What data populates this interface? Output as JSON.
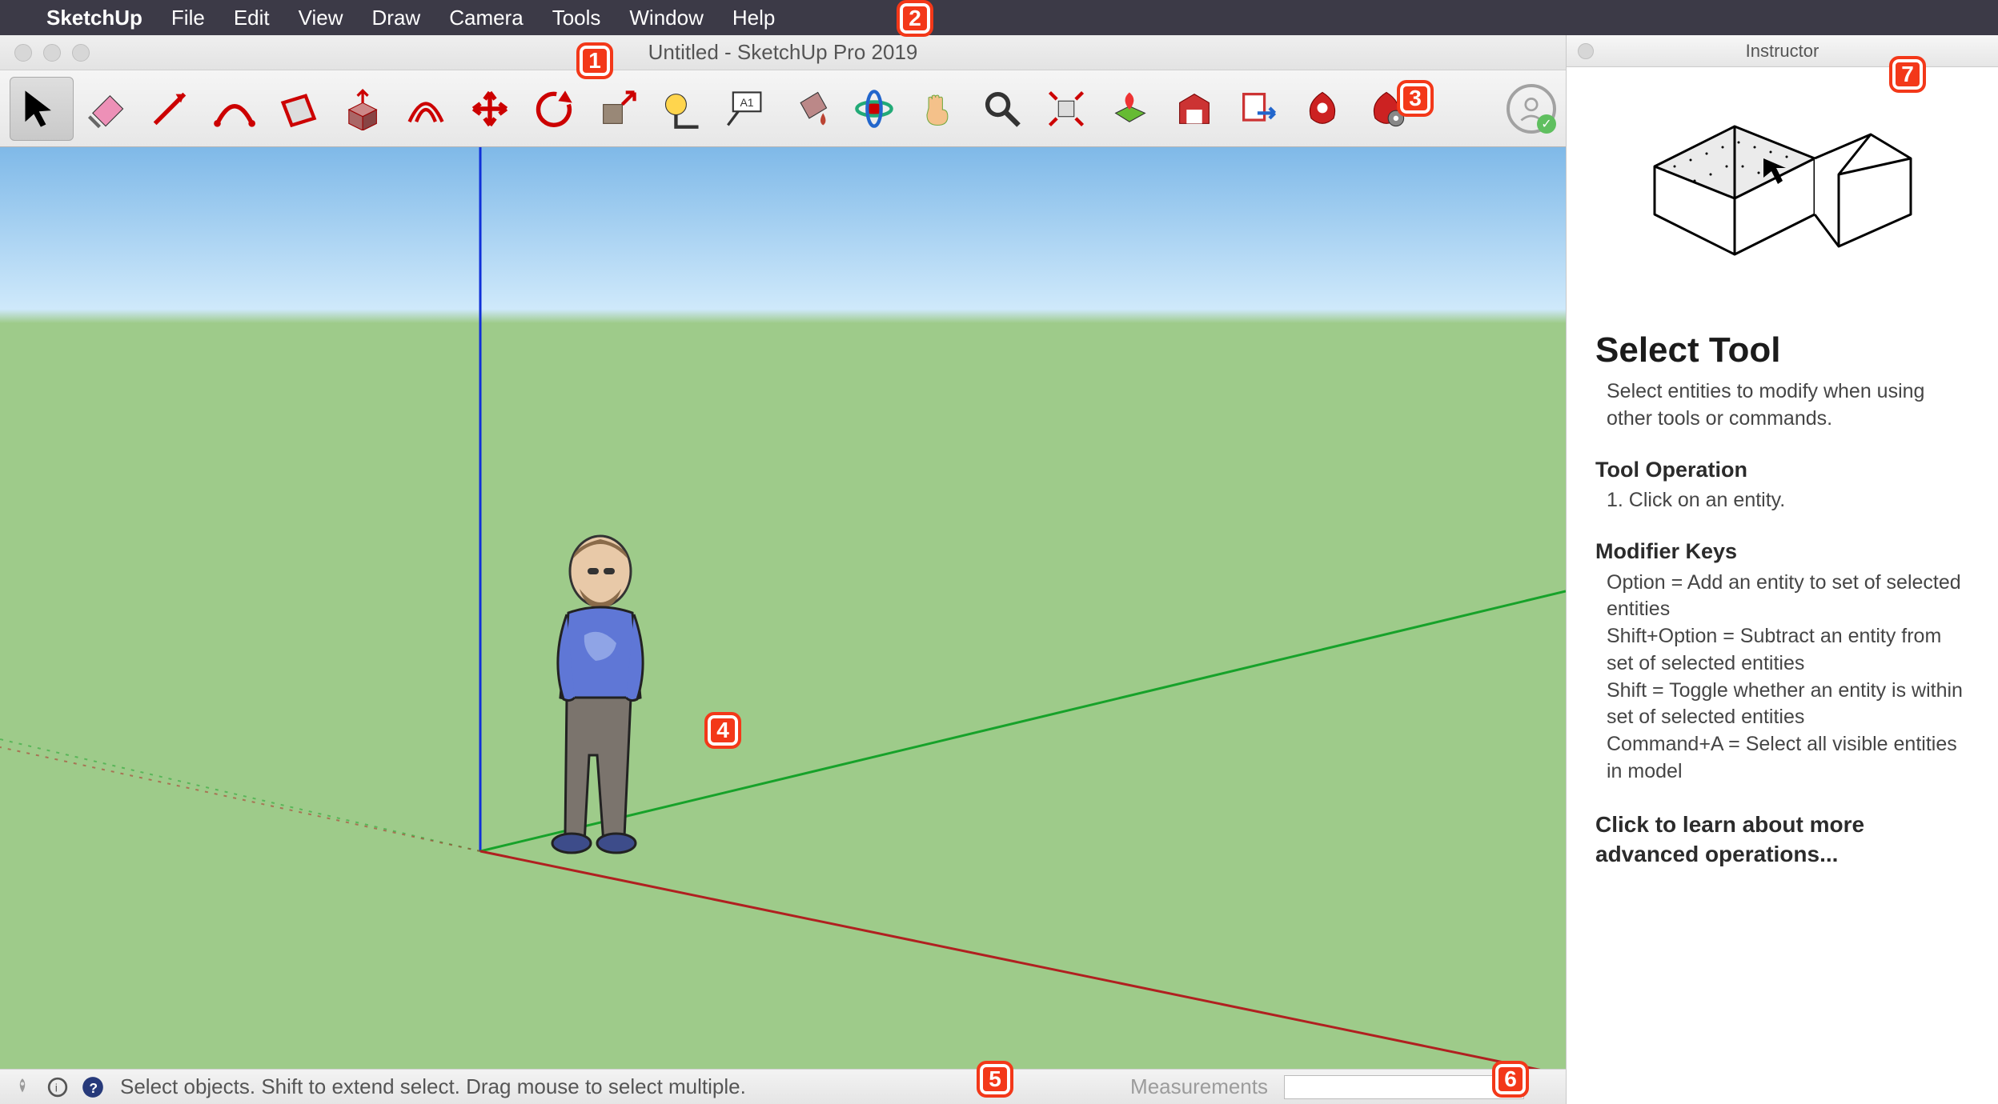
{
  "menubar": {
    "app": "SketchUp",
    "items": [
      "File",
      "Edit",
      "View",
      "Draw",
      "Camera",
      "Tools",
      "Window",
      "Help"
    ]
  },
  "window_title": "Untitled - SketchUp Pro 2019",
  "toolbar_items": [
    {
      "name": "select-tool",
      "selected": true
    },
    {
      "name": "eraser-tool"
    },
    {
      "name": "line-tool"
    },
    {
      "name": "arc-tool"
    },
    {
      "name": "rectangle-tool"
    },
    {
      "name": "pushpull-tool"
    },
    {
      "name": "offset-tool"
    },
    {
      "name": "move-tool"
    },
    {
      "name": "rotate-tool"
    },
    {
      "name": "scale-tool"
    },
    {
      "name": "tapemeasure-tool"
    },
    {
      "name": "text-tool"
    },
    {
      "name": "paintbucket-tool"
    },
    {
      "name": "orbit-tool"
    },
    {
      "name": "pan-tool"
    },
    {
      "name": "zoom-tool"
    },
    {
      "name": "zoomextents-tool"
    },
    {
      "name": "addlocation-tool"
    },
    {
      "name": "3dwarehouse-tool"
    },
    {
      "name": "layoutsend-tool"
    },
    {
      "name": "extensionwarehouse-tool"
    },
    {
      "name": "extensionmanager-tool"
    }
  ],
  "status": {
    "hint": "Select objects. Shift to extend select. Drag mouse to select multiple.",
    "measure_label": "Measurements",
    "measure_value": ""
  },
  "instructor": {
    "panel_title": "Instructor",
    "title": "Select Tool",
    "desc": "Select entities to modify when using other tools or commands.",
    "operation_heading": "Tool Operation",
    "operation_step": "1. Click on an entity.",
    "modifiers_heading": "Modifier Keys",
    "mod1": "Option = Add an entity to set of selected entities",
    "mod2": "Shift+Option = Subtract an entity from set of selected entities",
    "mod3": "Shift = Toggle whether an entity is within set of selected entities",
    "mod4": "Command+A = Select all visible entities in model",
    "link": "Click to learn about more advanced operations..."
  },
  "callouts": {
    "c1": "1",
    "c2": "2",
    "c3": "3",
    "c4": "4",
    "c5": "5",
    "c6": "6",
    "c7": "7"
  }
}
